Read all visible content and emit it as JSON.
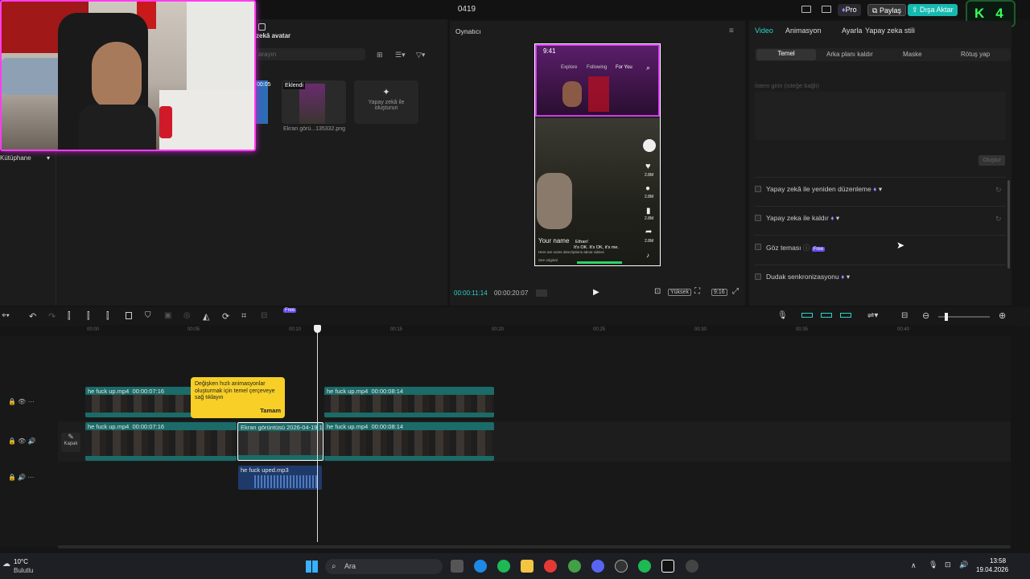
{
  "app": {
    "title": "0419",
    "pro": "Pro",
    "share": "Paylaş",
    "export": "Dışa Aktar"
  },
  "badge": {
    "letter": "K",
    "number": "4"
  },
  "library": {
    "header": "zekâ avatar",
    "search_placeholder": "arayın",
    "side_label": "Kütüphane",
    "thumb_badge": "Eklendi",
    "thumb_name": "Ekran görü...135332.png",
    "ai_card": "Yapay zekâ ile oluşturun",
    "duration": "00:05"
  },
  "player": {
    "title": "Oynatıcı",
    "time_current": "00:00:11:14",
    "time_total": "00:00:20:07",
    "quality": "Yüksek",
    "ratio": "9:16"
  },
  "phone": {
    "time": "9:41",
    "tabs": [
      "Explore",
      "Following",
      "For You"
    ],
    "caption_name": "Your name",
    "caption_line1": "Ethan!",
    "caption_line2": "It's OK. It's OK, it's me.",
    "desc": "Here are some descriptions about videos",
    "sound": "See original",
    "likes": "2.8M",
    "comments": "2.8M",
    "saves": "2.8M",
    "shares": "2.8M"
  },
  "inspector": {
    "tabs": [
      "Video",
      "Animasyon",
      "Ayarla",
      "Yapay zeka stili"
    ],
    "subtabs": [
      "Temel",
      "Arka planı kaldır",
      "Maske",
      "Rötuş yap"
    ],
    "prompt_label": "İstem girin (isteğe bağlı)",
    "generate": "Oluştur",
    "features": [
      "Yapay zekâ ile yeniden düzenleme",
      "Yapay zeka ile kaldır",
      "Göz teması",
      "Dudak senkronizasyonu"
    ],
    "free": "Free"
  },
  "ruler": [
    "00:00",
    "00:05",
    "00:10",
    "00:15",
    "00:20",
    "00:25",
    "00:30",
    "00:35",
    "00:40"
  ],
  "timeline": {
    "cover": "Kapak",
    "free": "Free",
    "clips": [
      {
        "name": "he fuck up.mp4",
        "dur": "00:00:07:16"
      },
      {
        "name": "he fuck up.mp4",
        "dur": "00:00:08:14"
      },
      {
        "name": "he fuck up.mp4",
        "dur": "00:00:07:16"
      },
      {
        "name": "Ekran görüntüsü 2026-04-19 135",
        "dur": ""
      },
      {
        "name": "he fuck up.mp4",
        "dur": "00:00:08:14"
      },
      {
        "name": "he fuck uped.mp3",
        "dur": ""
      }
    ]
  },
  "tooltip": {
    "text": "Değişken hızlı animasyonlar oluşturmak için temel çerçeveye sağ tıklayın",
    "ok": "Tamam"
  },
  "taskbar": {
    "temp": "10°C",
    "weather": "Bulutlu",
    "search": "Ara",
    "time": "13:58",
    "date": "19.04.2026"
  },
  "colors": {
    "accent": "#2ad4c8",
    "export_bg": "#16b9b0",
    "tooltip": "#f7cf27",
    "clip": "#1b6b68",
    "webcam_border": "#ff3cf0"
  }
}
